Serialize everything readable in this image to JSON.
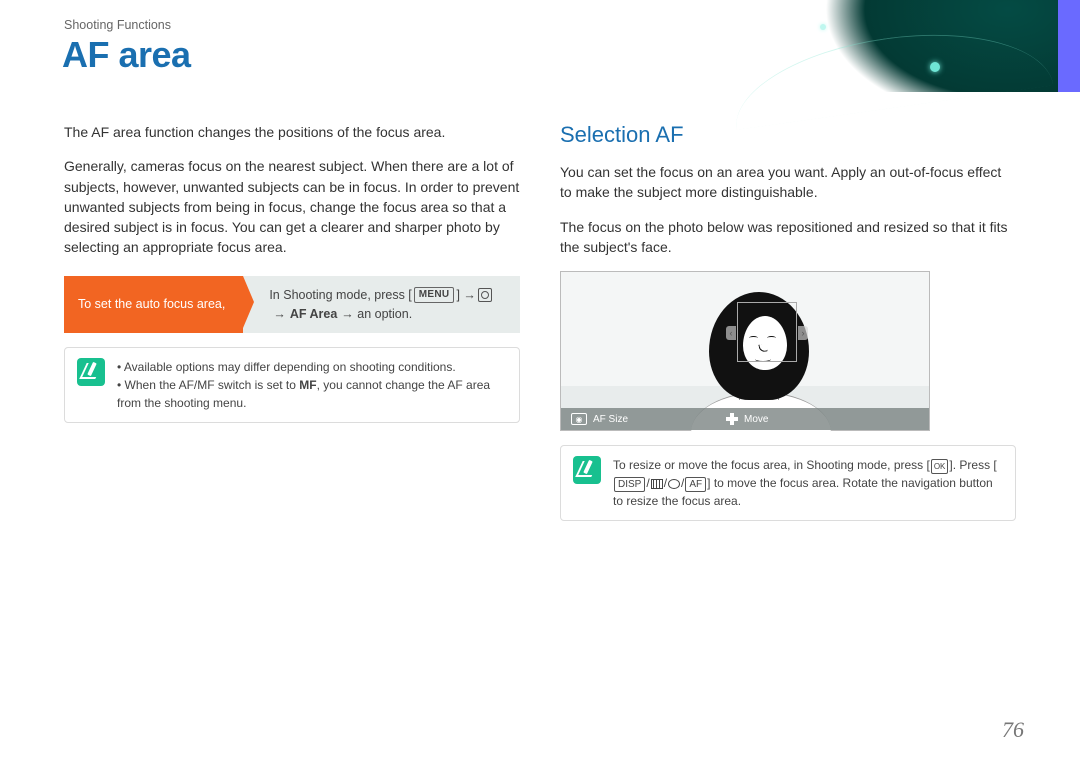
{
  "header": {
    "breadcrumb": "Shooting Functions",
    "title": "AF area"
  },
  "left": {
    "intro": "The AF area function changes the positions of the focus area.",
    "body": "Generally, cameras focus on the nearest subject. When there are a lot of subjects, however, unwanted subjects can be in focus. In order to prevent unwanted subjects from being in focus, change the focus area so that a desired subject is in focus. You can get a clearer and sharper photo by selecting an appropriate focus area.",
    "instr_flag": "To set the auto focus area,",
    "instr_pre": "In Shooting mode, press [",
    "instr_menu": "MENU",
    "instr_post1": "] →",
    "instr_afarea": "AF Area",
    "instr_post2": "→ an option.",
    "note1": "Available options may differ depending on shooting conditions.",
    "note2_a": "When the AF/MF switch is set to ",
    "note2_b": "MF",
    "note2_c": ", you cannot change the AF area from the shooting menu."
  },
  "right": {
    "heading": "Selection AF",
    "p1": "You can set the focus on an area you want. Apply an out-of-focus effect to make the subject more distinguishable.",
    "p2": "The focus on the photo below was repositioned and resized so that it fits the subject's face.",
    "afsize_label": "AF Size",
    "move_label": "Move",
    "note_a": "To resize or move the focus area, in Shooting mode, press [",
    "ok_label": "OK",
    "note_b": "]. Press [",
    "disp_label": "DISP",
    "af_label": "AF",
    "note_c": "] to move the focus area. Rotate the navigation button to resize the focus area."
  },
  "page_number": "76"
}
